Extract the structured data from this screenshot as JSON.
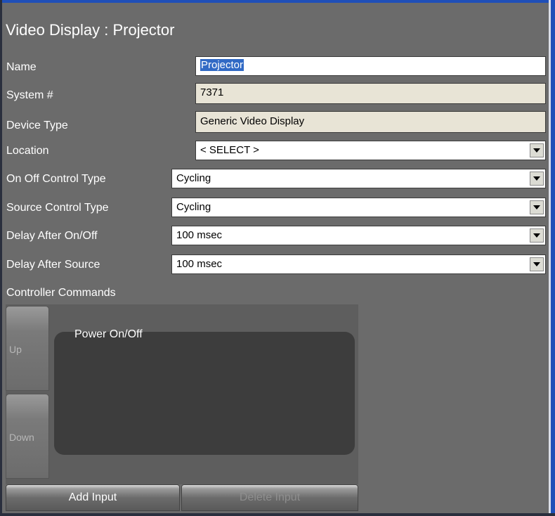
{
  "window": {
    "title": "Video Display : Projector"
  },
  "form": {
    "name": {
      "label": "Name",
      "value_selected": "Projector",
      "value_rest": ""
    },
    "system_number": {
      "label": "System #",
      "value": "7371"
    },
    "device_type": {
      "label": "Device Type",
      "value": "Generic Video Display"
    },
    "location": {
      "label": "Location",
      "value": "< SELECT >"
    },
    "on_off_control_type": {
      "label": "On Off Control Type",
      "value": "Cycling"
    },
    "source_control_type": {
      "label": "Source Control Type",
      "value": "Cycling"
    },
    "delay_after_on_off": {
      "label": "Delay After On/Off",
      "value": "100 msec"
    },
    "delay_after_source": {
      "label": "Delay After Source",
      "value": "100 msec"
    }
  },
  "controller_commands": {
    "label": "Controller Commands",
    "items": [
      "Power On/Off"
    ],
    "up_label": "Up",
    "down_label": "Down",
    "add_input_label": "Add Input",
    "delete_input_label": "Delete Input",
    "delete_input_enabled": false
  },
  "colors": {
    "background": "#6b6b6b",
    "accent_selection": "#316ac5",
    "readonly_field": "#e8e4d6",
    "command_list_bg": "#3d3d3d"
  }
}
